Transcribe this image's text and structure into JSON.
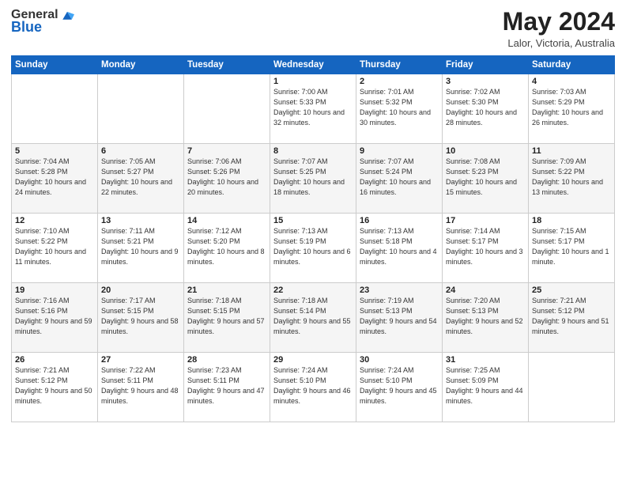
{
  "app": {
    "logo_general": "General",
    "logo_blue": "Blue",
    "month_year": "May 2024",
    "location": "Lalor, Victoria, Australia"
  },
  "calendar": {
    "headers": [
      "Sunday",
      "Monday",
      "Tuesday",
      "Wednesday",
      "Thursday",
      "Friday",
      "Saturday"
    ],
    "rows": [
      [
        {
          "day": "",
          "sunrise": "",
          "sunset": "",
          "daylight": ""
        },
        {
          "day": "",
          "sunrise": "",
          "sunset": "",
          "daylight": ""
        },
        {
          "day": "",
          "sunrise": "",
          "sunset": "",
          "daylight": ""
        },
        {
          "day": "1",
          "sunrise": "Sunrise: 7:00 AM",
          "sunset": "Sunset: 5:33 PM",
          "daylight": "Daylight: 10 hours and 32 minutes."
        },
        {
          "day": "2",
          "sunrise": "Sunrise: 7:01 AM",
          "sunset": "Sunset: 5:32 PM",
          "daylight": "Daylight: 10 hours and 30 minutes."
        },
        {
          "day": "3",
          "sunrise": "Sunrise: 7:02 AM",
          "sunset": "Sunset: 5:30 PM",
          "daylight": "Daylight: 10 hours and 28 minutes."
        },
        {
          "day": "4",
          "sunrise": "Sunrise: 7:03 AM",
          "sunset": "Sunset: 5:29 PM",
          "daylight": "Daylight: 10 hours and 26 minutes."
        }
      ],
      [
        {
          "day": "5",
          "sunrise": "Sunrise: 7:04 AM",
          "sunset": "Sunset: 5:28 PM",
          "daylight": "Daylight: 10 hours and 24 minutes."
        },
        {
          "day": "6",
          "sunrise": "Sunrise: 7:05 AM",
          "sunset": "Sunset: 5:27 PM",
          "daylight": "Daylight: 10 hours and 22 minutes."
        },
        {
          "day": "7",
          "sunrise": "Sunrise: 7:06 AM",
          "sunset": "Sunset: 5:26 PM",
          "daylight": "Daylight: 10 hours and 20 minutes."
        },
        {
          "day": "8",
          "sunrise": "Sunrise: 7:07 AM",
          "sunset": "Sunset: 5:25 PM",
          "daylight": "Daylight: 10 hours and 18 minutes."
        },
        {
          "day": "9",
          "sunrise": "Sunrise: 7:07 AM",
          "sunset": "Sunset: 5:24 PM",
          "daylight": "Daylight: 10 hours and 16 minutes."
        },
        {
          "day": "10",
          "sunrise": "Sunrise: 7:08 AM",
          "sunset": "Sunset: 5:23 PM",
          "daylight": "Daylight: 10 hours and 15 minutes."
        },
        {
          "day": "11",
          "sunrise": "Sunrise: 7:09 AM",
          "sunset": "Sunset: 5:22 PM",
          "daylight": "Daylight: 10 hours and 13 minutes."
        }
      ],
      [
        {
          "day": "12",
          "sunrise": "Sunrise: 7:10 AM",
          "sunset": "Sunset: 5:22 PM",
          "daylight": "Daylight: 10 hours and 11 minutes."
        },
        {
          "day": "13",
          "sunrise": "Sunrise: 7:11 AM",
          "sunset": "Sunset: 5:21 PM",
          "daylight": "Daylight: 10 hours and 9 minutes."
        },
        {
          "day": "14",
          "sunrise": "Sunrise: 7:12 AM",
          "sunset": "Sunset: 5:20 PM",
          "daylight": "Daylight: 10 hours and 8 minutes."
        },
        {
          "day": "15",
          "sunrise": "Sunrise: 7:13 AM",
          "sunset": "Sunset: 5:19 PM",
          "daylight": "Daylight: 10 hours and 6 minutes."
        },
        {
          "day": "16",
          "sunrise": "Sunrise: 7:13 AM",
          "sunset": "Sunset: 5:18 PM",
          "daylight": "Daylight: 10 hours and 4 minutes."
        },
        {
          "day": "17",
          "sunrise": "Sunrise: 7:14 AM",
          "sunset": "Sunset: 5:17 PM",
          "daylight": "Daylight: 10 hours and 3 minutes."
        },
        {
          "day": "18",
          "sunrise": "Sunrise: 7:15 AM",
          "sunset": "Sunset: 5:17 PM",
          "daylight": "Daylight: 10 hours and 1 minute."
        }
      ],
      [
        {
          "day": "19",
          "sunrise": "Sunrise: 7:16 AM",
          "sunset": "Sunset: 5:16 PM",
          "daylight": "Daylight: 9 hours and 59 minutes."
        },
        {
          "day": "20",
          "sunrise": "Sunrise: 7:17 AM",
          "sunset": "Sunset: 5:15 PM",
          "daylight": "Daylight: 9 hours and 58 minutes."
        },
        {
          "day": "21",
          "sunrise": "Sunrise: 7:18 AM",
          "sunset": "Sunset: 5:15 PM",
          "daylight": "Daylight: 9 hours and 57 minutes."
        },
        {
          "day": "22",
          "sunrise": "Sunrise: 7:18 AM",
          "sunset": "Sunset: 5:14 PM",
          "daylight": "Daylight: 9 hours and 55 minutes."
        },
        {
          "day": "23",
          "sunrise": "Sunrise: 7:19 AM",
          "sunset": "Sunset: 5:13 PM",
          "daylight": "Daylight: 9 hours and 54 minutes."
        },
        {
          "day": "24",
          "sunrise": "Sunrise: 7:20 AM",
          "sunset": "Sunset: 5:13 PM",
          "daylight": "Daylight: 9 hours and 52 minutes."
        },
        {
          "day": "25",
          "sunrise": "Sunrise: 7:21 AM",
          "sunset": "Sunset: 5:12 PM",
          "daylight": "Daylight: 9 hours and 51 minutes."
        }
      ],
      [
        {
          "day": "26",
          "sunrise": "Sunrise: 7:21 AM",
          "sunset": "Sunset: 5:12 PM",
          "daylight": "Daylight: 9 hours and 50 minutes."
        },
        {
          "day": "27",
          "sunrise": "Sunrise: 7:22 AM",
          "sunset": "Sunset: 5:11 PM",
          "daylight": "Daylight: 9 hours and 48 minutes."
        },
        {
          "day": "28",
          "sunrise": "Sunrise: 7:23 AM",
          "sunset": "Sunset: 5:11 PM",
          "daylight": "Daylight: 9 hours and 47 minutes."
        },
        {
          "day": "29",
          "sunrise": "Sunrise: 7:24 AM",
          "sunset": "Sunset: 5:10 PM",
          "daylight": "Daylight: 9 hours and 46 minutes."
        },
        {
          "day": "30",
          "sunrise": "Sunrise: 7:24 AM",
          "sunset": "Sunset: 5:10 PM",
          "daylight": "Daylight: 9 hours and 45 minutes."
        },
        {
          "day": "31",
          "sunrise": "Sunrise: 7:25 AM",
          "sunset": "Sunset: 5:09 PM",
          "daylight": "Daylight: 9 hours and 44 minutes."
        },
        {
          "day": "",
          "sunrise": "",
          "sunset": "",
          "daylight": ""
        }
      ]
    ]
  }
}
